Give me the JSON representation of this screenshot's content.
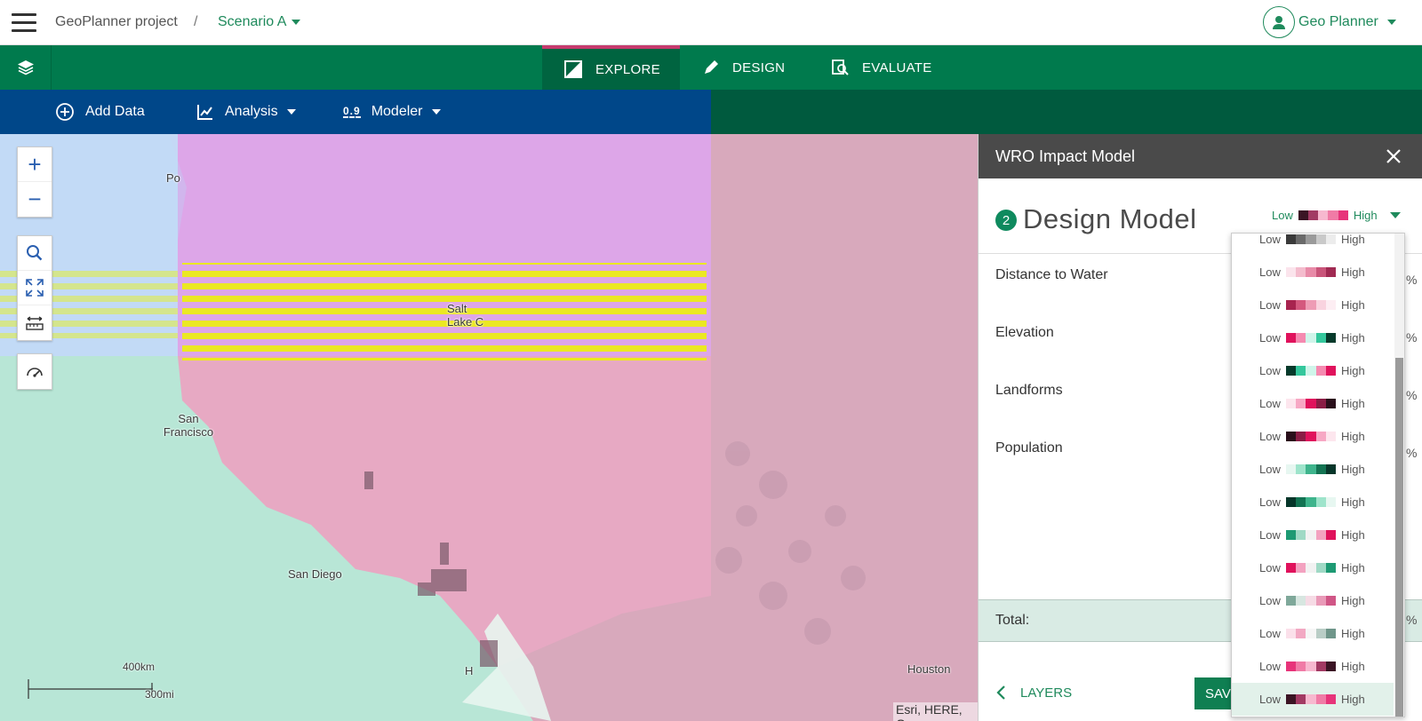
{
  "header": {
    "project": "GeoPlanner project",
    "separator": "/",
    "scenario": "Scenario A",
    "user": "Geo Planner"
  },
  "nav": {
    "tabs": [
      {
        "label": "EXPLORE",
        "active": true
      },
      {
        "label": "DESIGN",
        "active": false
      },
      {
        "label": "EVALUATE",
        "active": false
      }
    ]
  },
  "toolbar": {
    "add_data": "Add Data",
    "analysis": "Analysis",
    "modeler": "Modeler",
    "modeler_icon_text": "0.9"
  },
  "map": {
    "labels": {
      "portland": "Po",
      "salt_lake": "Salt Lake C",
      "san_francisco": "San Francisco",
      "san_diego": "San Diego",
      "houston": "Houston",
      "hermosillo": "H"
    },
    "scale_km": "400km",
    "scale_mi": "300mi",
    "attribution": "Esri, HERE, G"
  },
  "panel": {
    "title": "WRO Impact Model",
    "step": "2",
    "model_title": "Design Model",
    "ramp_low": "Low",
    "ramp_high": "High",
    "factors": [
      "Distance to Water",
      "Elevation",
      "Landforms",
      "Population"
    ],
    "pct": "%",
    "total_label": "Total:",
    "back_label": "LAYERS",
    "save_label": "SAV"
  },
  "dropdown": {
    "low": "Low",
    "high": "High",
    "items": [
      {
        "colors": [
          "#3a3a3a",
          "#6a6a6a",
          "#9a9a9a",
          "#c9c9c9",
          "#ececec"
        ]
      },
      {
        "colors": [
          "#fbe4ec",
          "#f4bccd",
          "#e88ba8",
          "#c9557a",
          "#a02a52"
        ]
      },
      {
        "colors": [
          "#a8244f",
          "#d4587e",
          "#ee9cb5",
          "#f9d3df",
          "#fdeef3"
        ]
      },
      {
        "colors": [
          "#e0125c",
          "#f58ab0",
          "#cff5ea",
          "#34c79c",
          "#063a2b"
        ]
      },
      {
        "colors": [
          "#063a2b",
          "#34c79c",
          "#cff5ea",
          "#f58ab0",
          "#e0125c"
        ]
      },
      {
        "colors": [
          "#fde6ee",
          "#f7a8c4",
          "#e0125c",
          "#8a1d45",
          "#2a0f1b"
        ]
      },
      {
        "colors": [
          "#2a0f1b",
          "#8a1d45",
          "#e0125c",
          "#f7a8c4",
          "#fde6ee"
        ]
      },
      {
        "colors": [
          "#e7f7f1",
          "#9ee4cb",
          "#3eb48c",
          "#137352",
          "#07362a"
        ]
      },
      {
        "colors": [
          "#07362a",
          "#137352",
          "#3eb48c",
          "#9ee4cb",
          "#e7f7f1"
        ]
      },
      {
        "colors": [
          "#1d9a73",
          "#9fd9c5",
          "#f2f2f2",
          "#f3a2c0",
          "#e0125c"
        ]
      },
      {
        "colors": [
          "#e0125c",
          "#f3a2c0",
          "#f2f2f2",
          "#9fd9c5",
          "#1d9a73"
        ]
      },
      {
        "colors": [
          "#7fa89a",
          "#d7e6e0",
          "#f6dbe5",
          "#e99ab8",
          "#d05686"
        ]
      },
      {
        "colors": [
          "#fbe0ea",
          "#f2a9c3",
          "#f6f6f6",
          "#b9cdc6",
          "#6f968a"
        ]
      },
      {
        "colors": [
          "#e7347a",
          "#f07ba6",
          "#f7b8cf",
          "#a23a63",
          "#3b1424"
        ]
      },
      {
        "colors": [
          "#3b1424",
          "#a23a63",
          "#f7b8cf",
          "#f07ba6",
          "#e7347a"
        ]
      }
    ],
    "selected_index": 14
  },
  "colors": {
    "brand_green": "#007a4d",
    "toolbar_blue": "#004789",
    "active_tab_accent": "#c63a6e",
    "panel_header": "#4a4a4a"
  }
}
